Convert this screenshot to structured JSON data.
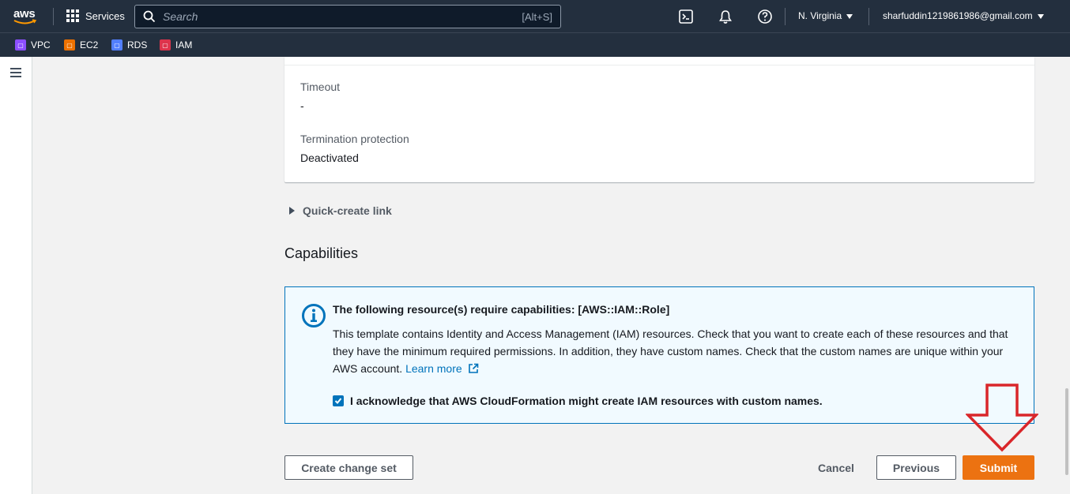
{
  "topnav": {
    "logo_text": "aws",
    "services_label": "Services",
    "search_placeholder": "Search",
    "search_shortcut": "[Alt+S]",
    "region_label": "N. Virginia",
    "account_label": "sharfuddin1219861986@gmail.com"
  },
  "favorites": [
    {
      "label": "VPC",
      "color": "#8c4fff"
    },
    {
      "label": "EC2",
      "color": "#ed7100"
    },
    {
      "label": "RDS",
      "color": "#527fff"
    },
    {
      "label": "IAM",
      "color": "#dd344c"
    }
  ],
  "details": {
    "timeout_label": "Timeout",
    "timeout_value": "-",
    "termination_label": "Termination protection",
    "termination_value": "Deactivated"
  },
  "quick_create_label": "Quick-create link",
  "capabilities": {
    "heading": "Capabilities",
    "alert_title": "The following resource(s) require capabilities: [AWS::IAM::Role]",
    "alert_body": "This template contains Identity and Access Management (IAM) resources. Check that you want to create each of these resources and that they have the minimum required permissions. In addition, they have custom names. Check that the custom names are unique within your AWS account.",
    "learn_more": "Learn more",
    "acknowledge": "I acknowledge that AWS CloudFormation might create IAM resources with custom names."
  },
  "footer": {
    "create_change_set": "Create change set",
    "cancel": "Cancel",
    "previous": "Previous",
    "submit": "Submit"
  },
  "colors": {
    "nav_bg": "#232f3e",
    "primary": "#ec7211",
    "info": "#0073bb",
    "annotation": "#d9262a"
  }
}
